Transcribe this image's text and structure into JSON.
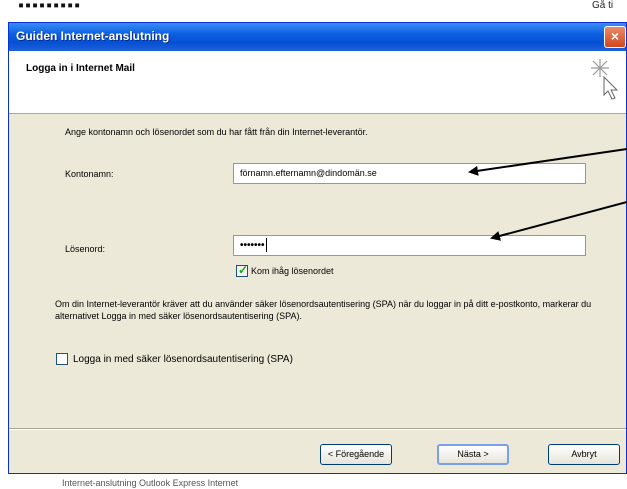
{
  "background": {
    "top_left_text": "▪▪▪▪▪▪▪▪▪",
    "top_right_text": "Gå ti",
    "bottom_text": "Internet-anslutning Outlook Express Internet"
  },
  "window": {
    "title": "Guiden Internet-anslutning",
    "close_label": "×"
  },
  "header": {
    "title": "Logga in i Internet Mail",
    "icon": "wizard-star-icon"
  },
  "form": {
    "intro": "Ange kontonamn och lösenordet som du har fått från din Internet-leverantör.",
    "account_label": "Kontonamn:",
    "account_value": "förnamn.efternamn@dindomän.se",
    "password_label": "Lösenord:",
    "password_value": "•••••••",
    "remember_label": "Kom ihåg lösenordet",
    "remember_checked": true,
    "spa_text": "Om din Internet-leverantör kräver att du använder säker lösenordsautentisering (SPA) när du loggar in på ditt e-postkonto, markerar du alternativet Logga in med säker lösenordsautentisering (SPA).",
    "spa_label": "Logga in med säker lösenordsautentisering (SPA)",
    "spa_checked": false
  },
  "buttons": {
    "back": "< Föregående",
    "next": "Nästa >",
    "cancel": "Avbryt"
  },
  "colors": {
    "titlebar": "#0b5fe0",
    "dialog_bg": "#ece9d8",
    "arrow": "#000000"
  }
}
